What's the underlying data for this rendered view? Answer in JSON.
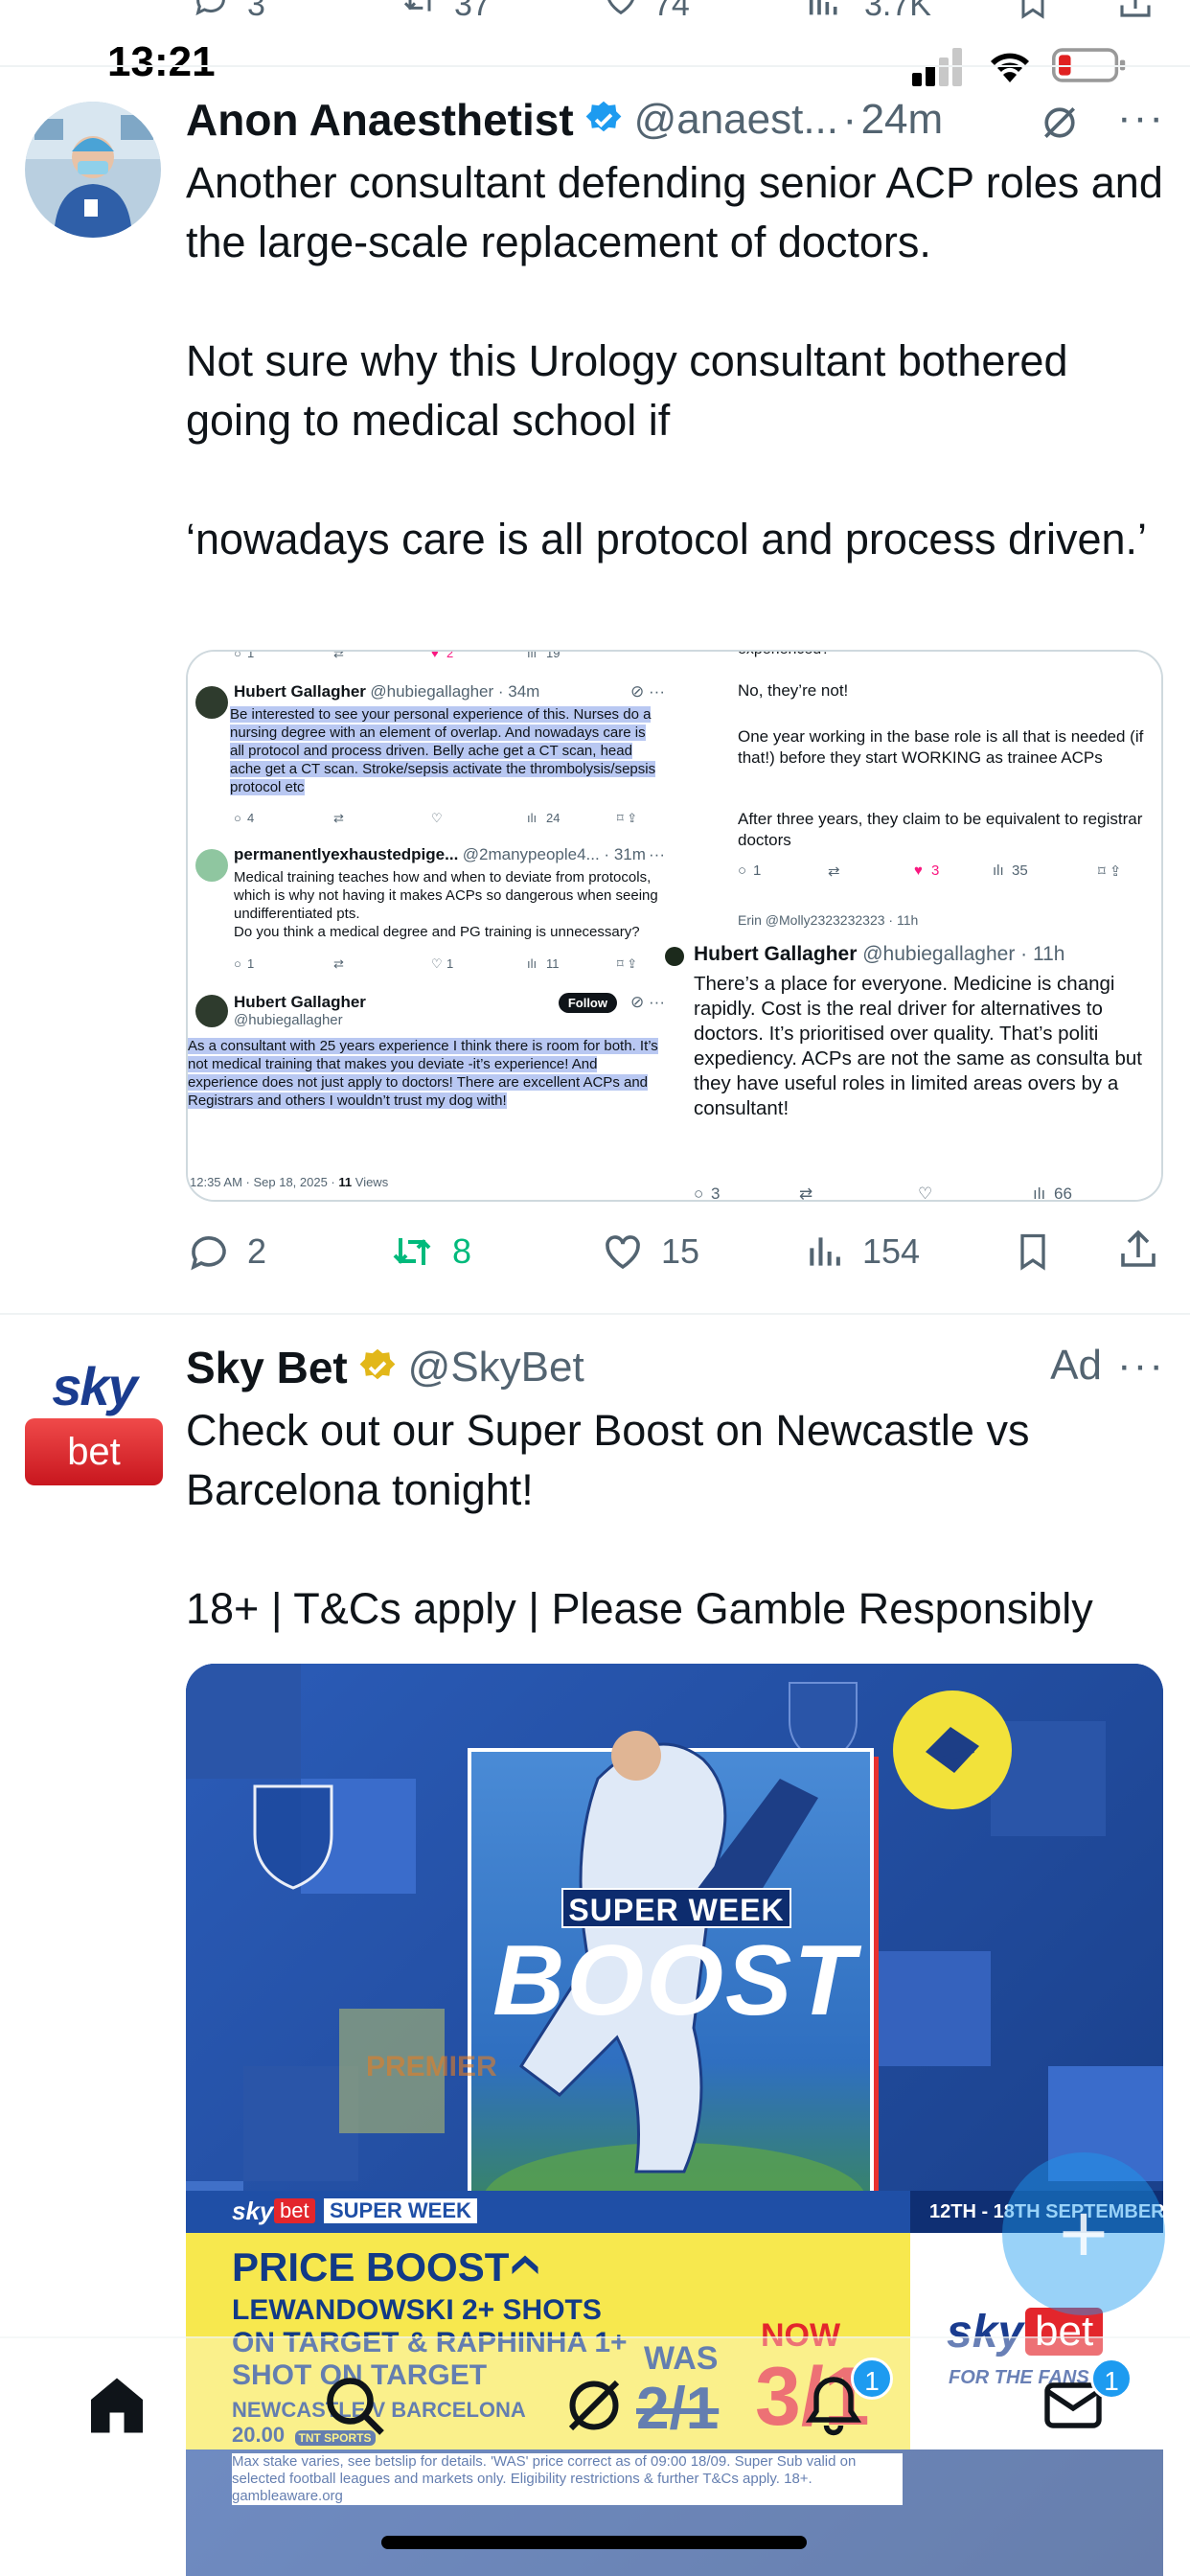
{
  "status_bar": {
    "time": "13:21"
  },
  "prev_tweet_actions": {
    "replies": "3",
    "reposts": "37",
    "likes": "74",
    "views": "3.7K"
  },
  "tweet1": {
    "name": "Anon Anaesthetist",
    "handle": "@anaest...",
    "time": "24m",
    "text": "Another consultant defending senior ACP roles and the large-scale replacement of doctors.\n\nNot sure why this Urology consultant bothered going to medical school if\n\n‘nowadays care is all protocol and process driven.’",
    "actions": {
      "replies": "2",
      "reposts": "8",
      "likes": "15",
      "views": "154"
    },
    "embed": {
      "left": {
        "top_counts": {
          "replies": "1",
          "likes": "2",
          "views": "19"
        },
        "tweet_a": {
          "name": "Hubert Gallagher",
          "handle": "@hubiegallagher · 34m",
          "text": "Be interested to see your personal experience of this.  Nurses do a nursing degree with an element of overlap.  And nowadays care is all protocol and process driven.  Belly ache get a CT scan, head ache get a CT scan. Stroke/sepsis activate the thrombolysis/sepsis protocol etc",
          "replies": "4",
          "views": "24"
        },
        "tweet_b": {
          "name": "permanentlyexhaustedpige...",
          "handle": "@2manypeople4... · 31m",
          "text": "Medical training teaches how and when to deviate from protocols, which is why not having it makes ACPs so dangerous when seeing undifferentiated pts.\nDo you think a medical degree and PG training is unnecessary?",
          "replies": "1",
          "likes": "1",
          "views": "11"
        },
        "tweet_c": {
          "name": "Hubert Gallagher",
          "handle": "@hubiegallagher",
          "follow": "Follow",
          "text": "As a consultant with 25 years experience I think there is room for both.  It’s not medical training that makes you deviate -it’s experience!  And experience does not just apply to doctors!  There are excellent ACPs and Registrars and others I wouldn’t trust my dog with!",
          "meta_time": "12:35 AM · Sep 18, 2025 · ",
          "meta_views_num": "11",
          "meta_views_label": " Views"
        }
      },
      "right_top": {
        "partial_top": "experienced?",
        "text1": "No, they’re not!",
        "text2": "One year working in the base role is all that is needed (if that!) before they start WORKING as trainee ACPs",
        "text3": "After three years, they claim to be equivalent to registrar doctors",
        "replies": "1",
        "likes": "3",
        "views": "35",
        "partial_bottom": "Erin @Molly2323232323 · 11h"
      },
      "right_bottom": {
        "name": "Hubert Gallagher",
        "handle": "@hubiegallagher · 11h",
        "text": "There’s a place for everyone. Medicine is changi rapidly. Cost is the real driver for alternatives to doctors.  It’s prioritised over quality. That’s politi expediency. ACPs are not the same as consulta but they have useful roles in limited areas overs by a consultant!",
        "replies": "3",
        "views": "66"
      }
    }
  },
  "tweet2": {
    "logo_top": "sky",
    "logo_bottom": "bet",
    "name": "Sky Bet",
    "handle": "@SkyBet",
    "ad_label": "Ad",
    "text": "Check out our Super Boost on Newcastle vs Barcelona tonight!\n\n18+ | T&Cs apply | Please Gamble Responsibly",
    "ad_image": {
      "super_week": "SUPER WEEK",
      "boost": "BOOST",
      "bar_brand_sky": "sky",
      "bar_brand_bet": "bet",
      "bar_tag": "SUPER WEEK",
      "dates": "12TH - 18TH SEPTEMBER",
      "price_boost": "PRICE BOOST",
      "offer_line1": "LEWANDOWSKI 2+ SHOTS",
      "offer_line2": "ON TARGET & RAPHINHA 1+",
      "offer_line3": "SHOT ON TARGET",
      "match": "NEWCASTLE V BARCELONA",
      "kickoff": "20.00",
      "broadcaster": "TNT SPORTS",
      "was_label": "WAS",
      "was_price": "2/1",
      "now_label": "NOW",
      "now_price": "3/1",
      "brand_sky": "sky",
      "brand_bet": "bet",
      "for_the_fans": "FOR THE FANS",
      "disclaimer": "Max stake varies, see betslip for details. 'WAS' price correct as of 09:00 18/09. Super Sub valid on selected football leagues and markets only. Eligibility restrictions & further T&Cs apply. 18+. gambleaware.org",
      "bg_text": "PREMIER"
    }
  },
  "fab": {
    "label": "+"
  },
  "tabbar": {
    "notifications_badge": "1",
    "messages_badge": "1"
  },
  "colors": {
    "accent": "#1d9bf0",
    "repost_green": "#00ba7c",
    "like_pink": "#f91880",
    "sky_red": "#e3262c",
    "boost_yellow": "#f7e84e"
  }
}
